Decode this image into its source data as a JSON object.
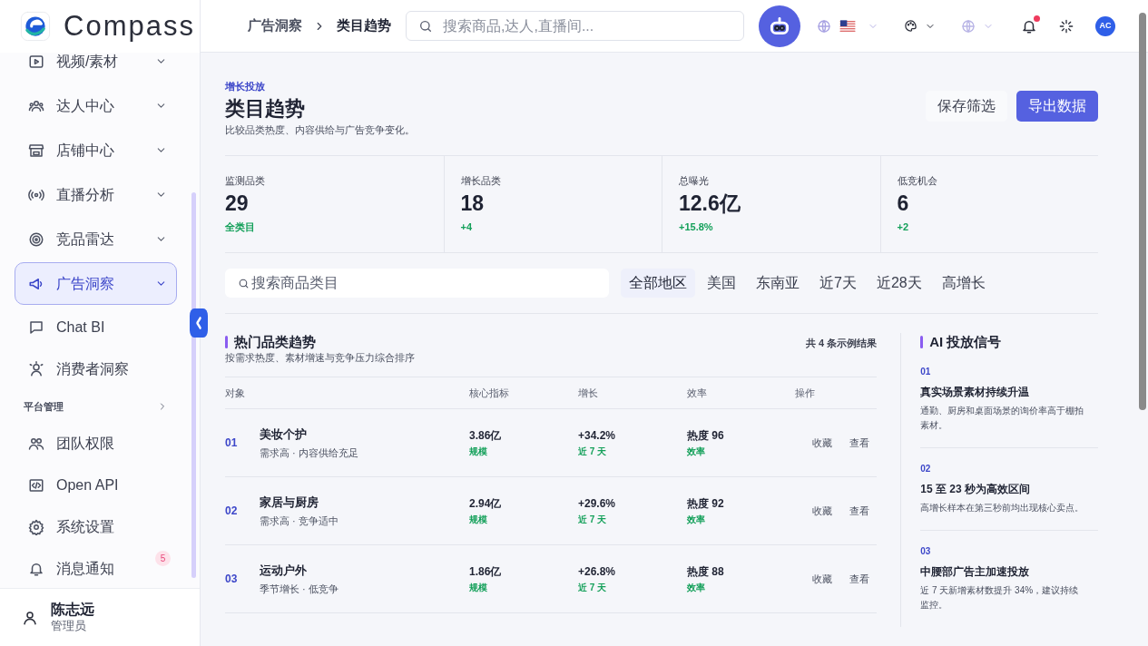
{
  "brand": {
    "name": "Compass"
  },
  "sidebar": {
    "items": [
      {
        "kind": "group",
        "label": "视频/素材",
        "selected": false
      },
      {
        "kind": "group",
        "label": "达人中心",
        "selected": false
      },
      {
        "kind": "group",
        "label": "店铺中心",
        "selected": false
      },
      {
        "kind": "group",
        "label": "直播分析",
        "selected": false
      },
      {
        "kind": "group",
        "label": "竞品雷达",
        "selected": false
      },
      {
        "kind": "group",
        "label": "广告洞察",
        "selected": true
      },
      {
        "kind": "link",
        "label": "Chat BI",
        "selected": false
      },
      {
        "kind": "link",
        "label": "消费者洞察",
        "selected": false
      },
      {
        "kind": "section",
        "label": "平台管理"
      },
      {
        "kind": "link",
        "label": "团队权限",
        "selected": false
      },
      {
        "kind": "link",
        "label": "Open API",
        "selected": false
      },
      {
        "kind": "link",
        "label": "系统设置",
        "selected": false
      },
      {
        "kind": "link",
        "label": "消息通知",
        "selected": false,
        "badge": "5"
      }
    ],
    "user": {
      "name": "陈志远",
      "role": "管理员"
    }
  },
  "header": {
    "breadcrumb": [
      "广告洞察",
      "类目趋势"
    ],
    "search": {
      "placeholder": "搜索商品,达人,直播间..."
    },
    "notifications_unread": true,
    "avatar": "AC"
  },
  "page": {
    "eyebrow": "增长投放",
    "title": "类目趋势",
    "subtitle": "比较品类热度、内容供给与广告竞争变化。",
    "buttons": [
      {
        "label": "保存筛选",
        "primary": false
      },
      {
        "label": "导出数据",
        "primary": true
      }
    ]
  },
  "stats": [
    {
      "label": "监测品类",
      "value": "29",
      "note": "全类目"
    },
    {
      "label": "增长品类",
      "value": "18",
      "note": "+4"
    },
    {
      "label": "总曝光",
      "value": "12.6亿",
      "note": "+15.8%"
    },
    {
      "label": "低竞机会",
      "value": "6",
      "note": "+2"
    }
  ],
  "filters": {
    "search": {
      "placeholder": "搜索商品类目"
    },
    "chips": [
      {
        "label": "全部地区",
        "selected": true
      },
      {
        "label": "美国",
        "selected": false
      },
      {
        "label": "东南亚",
        "selected": false
      },
      {
        "label": "近7天",
        "selected": false
      },
      {
        "label": "近28天",
        "selected": false
      },
      {
        "label": "高增长",
        "selected": false
      }
    ]
  },
  "table": {
    "title": "热门品类趋势",
    "subtitle": "按需求热度、素材增速与竞争压力综合排序",
    "count": "共 4 条示例结果",
    "columns": [
      "对象",
      "核心指标",
      "增长",
      "效率",
      "操作"
    ],
    "rows": [
      {
        "index": "01",
        "name": "美妆个护",
        "desc": "需求高 · 内容供给充足",
        "metric": "3.86亿",
        "metric_note": "规模",
        "growth": "+34.2%",
        "growth_note": "近 7 天",
        "efficiency": "热度 96",
        "efficiency_note": "效率",
        "actions": [
          "收藏",
          "查看"
        ]
      },
      {
        "index": "02",
        "name": "家居与厨房",
        "desc": "需求高 · 竞争适中",
        "metric": "2.94亿",
        "metric_note": "规模",
        "growth": "+29.6%",
        "growth_note": "近 7 天",
        "efficiency": "热度 92",
        "efficiency_note": "效率",
        "actions": [
          "收藏",
          "查看"
        ]
      },
      {
        "index": "03",
        "name": "运动户外",
        "desc": "季节增长 · 低竞争",
        "metric": "1.86亿",
        "metric_note": "规模",
        "growth": "+26.8%",
        "growth_note": "近 7 天",
        "efficiency": "热度 88",
        "efficiency_note": "效率",
        "actions": [
          "收藏",
          "查看"
        ]
      }
    ]
  },
  "signals": {
    "title": "AI 投放信号",
    "items": [
      {
        "index": "01",
        "title": "真实场景素材持续升温",
        "body": "通勤、厨房和桌面场景的询价率高于棚拍素材。"
      },
      {
        "index": "02",
        "title": "15 至 23 秒为高效区间",
        "body": "高增长样本在第三秒前均出现核心卖点。"
      },
      {
        "index": "03",
        "title": "中腰部广告主加速投放",
        "body": "近 7 天新增素材数提升 34%，建议持续监控。"
      }
    ]
  }
}
